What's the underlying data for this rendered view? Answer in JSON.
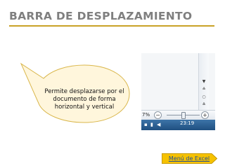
{
  "slide": {
    "title": "BARRA DE DESPLAZAMIENTO"
  },
  "callout": {
    "text": "Permite desplazarse por el documento de forma horizontal y vertical"
  },
  "excel": {
    "zoom_label": "7%",
    "zoom_minus": "−",
    "zoom_plus": "+",
    "clock": "23:19",
    "zoom_level": 0.5
  },
  "nav": {
    "menu_link": "Menú de Excel"
  },
  "colors": {
    "title": "#7f7f7f",
    "rule": "#c9a227",
    "callout_fill": "#fff6dc",
    "callout_border": "#d9b64a",
    "button_fill": "#f6c200",
    "link": "#1f4e9a"
  }
}
